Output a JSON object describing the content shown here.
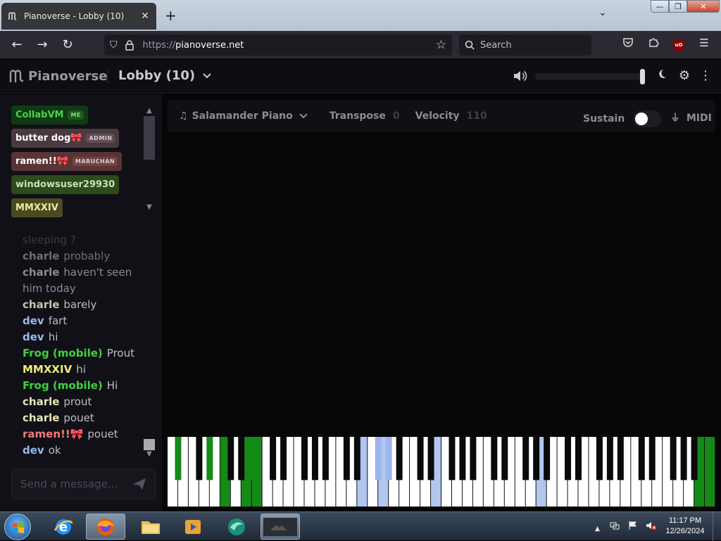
{
  "browser": {
    "tab_title": "Pianoverse - Lobby (10)",
    "tab_close": "✕",
    "new_tab": "+",
    "tab_list": "⌄",
    "url_protocol": "https://",
    "url_host": "pianoverse.net",
    "search_placeholder": "Search",
    "window_min": "—",
    "window_max": "❐",
    "window_close": "✕"
  },
  "header": {
    "brand": "Pianoverse",
    "room": "Lobby (10)",
    "volume_level": 0.98
  },
  "users": [
    {
      "name": "CollabVM",
      "badge": "ME",
      "bg": "#0f3a12",
      "fg": "#4cd04c",
      "badge_bg": "#1b5a1d",
      "badge_fg": "#8fd68f"
    },
    {
      "name": "butter dog🎀",
      "badge": "ADMIN",
      "bg": "#4a3a40",
      "fg": "#ffffff",
      "badge_bg": "#5f4d53",
      "badge_fg": "#d9c9cf"
    },
    {
      "name": "ramen!!🎀",
      "badge": "MARUCHAN",
      "bg": "#5a3434",
      "fg": "#ffffff",
      "badge_bg": "#6d4545",
      "badge_fg": "#e4c9c9"
    },
    {
      "name": "windowsuser29930",
      "badge": "",
      "bg": "#2d4a1a",
      "fg": "#c8e0b6"
    },
    {
      "name": "MMXXIV",
      "badge": "",
      "bg": "#4a4a22",
      "fg": "#ecec9c"
    }
  ],
  "chat": [
    {
      "name": "",
      "text": "sleeping ?",
      "color": "#3a3a42",
      "textcolor": "#3a3a42"
    },
    {
      "name": "charle",
      "text": "probably",
      "color": "#6d6d73",
      "textcolor": "#6d6d73"
    },
    {
      "name": "charle",
      "text": "haven't seen him today",
      "color": "#8b8b90",
      "textcolor": "#8b8b90"
    },
    {
      "name": "charle",
      "text": "barely",
      "color": "#c6c6aa",
      "textcolor": "#bdbdc6"
    },
    {
      "name": "dev",
      "text": "fart",
      "color": "#9ab8f0",
      "textcolor": "#bdbdc6"
    },
    {
      "name": "dev",
      "text": "hi",
      "color": "#9ab8f0",
      "textcolor": "#bdbdc6"
    },
    {
      "name": "Frog (mobile)",
      "text": "Prout",
      "color": "#3cd23c",
      "textcolor": "#bdbdc6"
    },
    {
      "name": "MMXXIV",
      "text": "hi",
      "color": "#ecec7a",
      "textcolor": "#bdbdc6"
    },
    {
      "name": "Frog (mobile)",
      "text": "Hi",
      "color": "#3cd23c",
      "textcolor": "#bdbdc6"
    },
    {
      "name": "charle",
      "text": "prout",
      "color": "#e6e6b4",
      "textcolor": "#bdbdc6"
    },
    {
      "name": "charle",
      "text": "pouet",
      "color": "#e6e6b4",
      "textcolor": "#bdbdc6"
    },
    {
      "name": "ramen!!🎀",
      "text": "pouet",
      "color": "#f07a7a",
      "textcolor": "#bdbdc6"
    },
    {
      "name": "dev",
      "text": "ok",
      "color": "#9ab8f0",
      "textcolor": "#bdbdc6"
    }
  ],
  "chat_input": {
    "placeholder": "Send a message..."
  },
  "toolbar": {
    "instrument": "Salamander Piano",
    "transpose_label": "Transpose",
    "transpose_value": "0",
    "velocity_label": "Velocity",
    "velocity_value": "110",
    "sustain_label": "Sustain",
    "sustain_on": false,
    "midi_label": "MIDI"
  },
  "piano": {
    "white_key_count": 52,
    "pressed_white": {
      "5": "#168a16",
      "7": "#168a16",
      "8": "#168a16",
      "18": "#b2c6f0",
      "20": "#b2c6f0",
      "25": "#b2c6f0",
      "35": "#b2c6f0",
      "50": "#168a16",
      "51": "#168a16"
    },
    "pressed_black": {
      "0": "#168a16",
      "2": "#168a16",
      "5": "#168a16",
      "13": "#9bb6ec",
      "14": "#9bb6ec",
      "36": "#9bb6ec"
    },
    "colors": {
      "white": "#ffffff",
      "black": "#0a0a0a"
    }
  },
  "taskbar": {
    "time": "11:17 PM",
    "date": "12/26/2024",
    "tray_arrow": "▲"
  }
}
